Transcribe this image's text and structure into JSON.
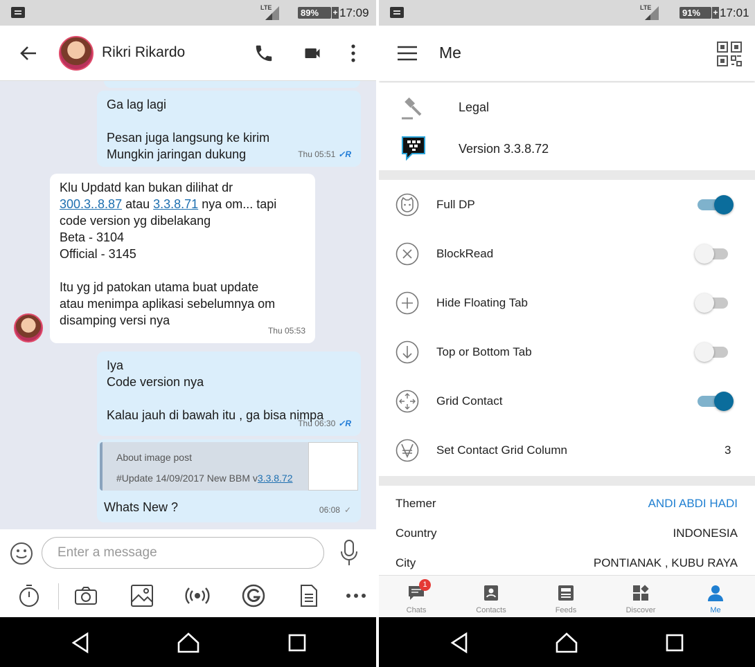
{
  "left": {
    "status": {
      "network": "LTE",
      "battery": "89%",
      "time": "17:09"
    },
    "header": {
      "contact_name": "Rikri Rikardo"
    },
    "messages": [
      {
        "dir": "out",
        "text": "Ga lag lagi\n\nPesan juga langsung ke kirim\nMungkin jaringan dukung",
        "time": "Thu 05:51",
        "receipt": "R"
      },
      {
        "dir": "in",
        "text_line1": "Klu Updatd kan bukan dilihat dr",
        "link1": "300.3..8.87",
        "mid": " atau ",
        "link2": "3.3.8.71",
        "after": " nya om... tapi",
        "text_rest": "code version yg dibelakang\nBeta - 3104\nOfficial - 3145\n\nItu yg jd patokan utama buat update\natau menimpa aplikasi sebelumnya om\ndisamping versi nya",
        "time": "Thu 05:53"
      },
      {
        "dir": "out",
        "text": "Iya\nCode version nya\n\nKalau jauh di bawah itu , ga bisa nimpa",
        "time": "Thu 06:30",
        "receipt": "R"
      },
      {
        "dir": "out",
        "quote_title": "About image post",
        "quote_text": "#Update 14/09/2017  New BBM v",
        "quote_link": "3.3.8.72",
        "text": "Whats New ?",
        "time": "06:08"
      }
    ],
    "input": {
      "placeholder": "Enter a message"
    }
  },
  "right": {
    "status": {
      "network": "LTE",
      "battery": "91%",
      "time": "17:01"
    },
    "header": {
      "title": "Me"
    },
    "about": [
      {
        "label": "Legal",
        "icon": "gavel-icon"
      },
      {
        "label": "Version 3.3.8.72",
        "icon": "bbm-logo-icon"
      }
    ],
    "settings": [
      {
        "label": "Full DP",
        "icon": "cat-face-icon",
        "on": true
      },
      {
        "label": "BlockRead",
        "icon": "x-circle-icon",
        "on": false
      },
      {
        "label": "Hide Floating Tab",
        "icon": "plus-circle-icon",
        "on": false
      },
      {
        "label": "Top or Bottom Tab",
        "icon": "arrow-down-circle-icon",
        "on": false
      },
      {
        "label": "Grid Contact",
        "icon": "move-arrows-icon",
        "on": true
      },
      {
        "label": "Set Contact Grid Column",
        "icon": "v-circle-icon",
        "value": "3"
      }
    ],
    "info": [
      {
        "key": "Themer",
        "value": "ANDI ABDI HADI"
      },
      {
        "key": "Country",
        "value": "INDONESIA"
      },
      {
        "key": "City",
        "value": "PONTIANAK , KUBU RAYA"
      }
    ],
    "tabs": [
      {
        "label": "Chats",
        "badge": "1"
      },
      {
        "label": "Contacts"
      },
      {
        "label": "Feeds"
      },
      {
        "label": "Discover"
      },
      {
        "label": "Me"
      }
    ]
  },
  "colors": {
    "accent": "#0b6d9c",
    "link": "#1f7fd1",
    "bubble_out": "#dbeefb",
    "chat_bg": "#e5e8f1"
  }
}
